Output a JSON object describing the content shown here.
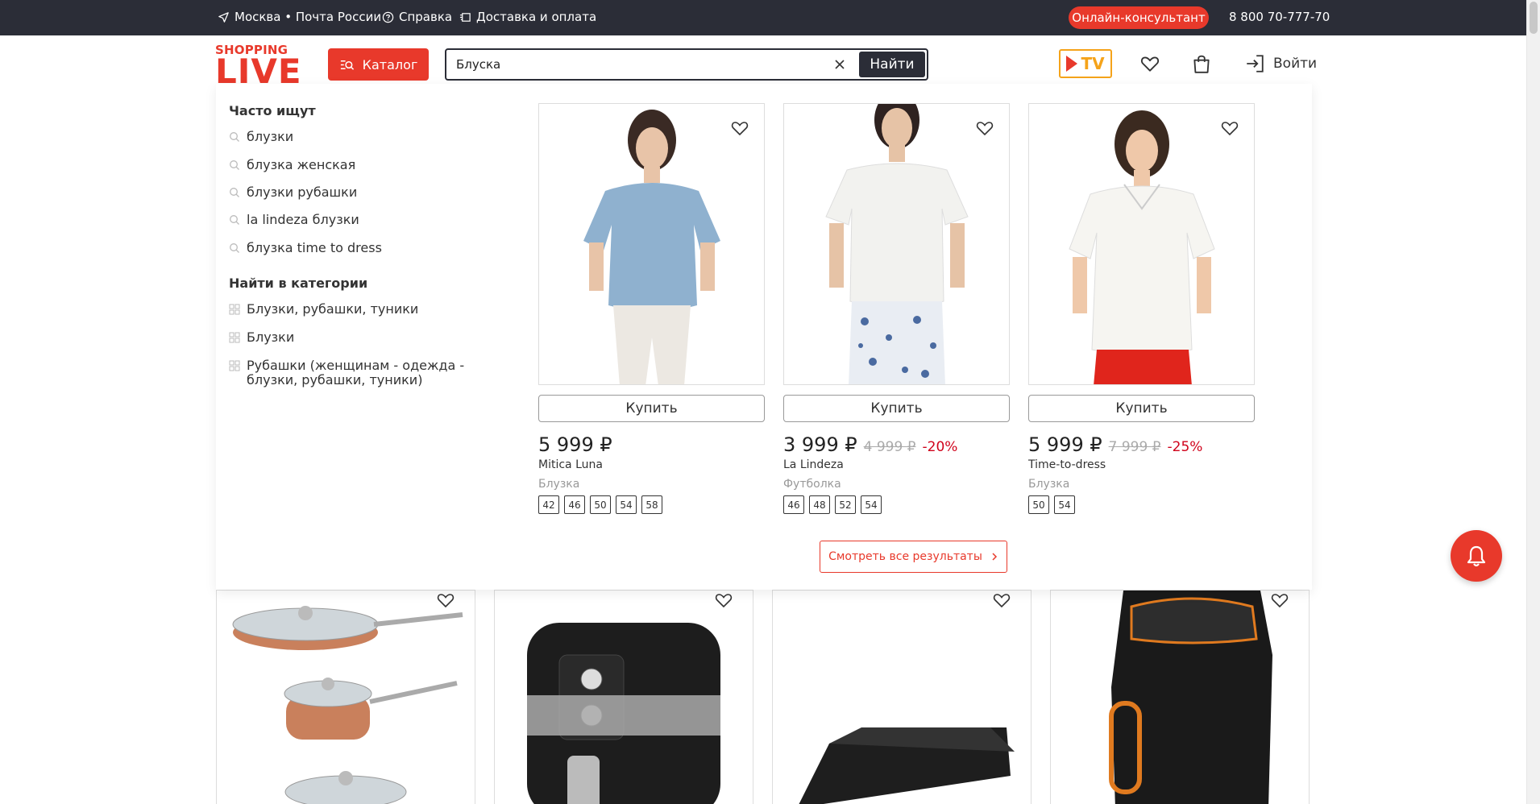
{
  "topbar": {
    "location": "Москва • Почта России",
    "help": "Справка",
    "delivery": "Доставка и оплата",
    "consultant": "Онлайн-консультант",
    "phone": "8 800 70-777-70"
  },
  "header": {
    "logo_top": "SHOPPING",
    "logo_bottom": "LIVE",
    "catalog": "Каталог",
    "search_value": "Блуска",
    "find": "Найти",
    "tv": "TV",
    "login": "Войти"
  },
  "dropdown": {
    "frequent_title": "Часто ищут",
    "frequent": [
      "блузки",
      "блузка женская",
      "блузки рубашки",
      "la lindeza блузки",
      "блузка time to dress"
    ],
    "category_title": "Найти в категории",
    "categories": [
      "Блузки, рубашки, туники",
      "Блузки",
      "Рубашки (женщинам - одежда - блузки, рубашки, туники)"
    ],
    "products": [
      {
        "buy": "Купить",
        "price": "5 999 ₽",
        "old_price": "",
        "discount": "",
        "brand": "Mitica Luna",
        "type": "Блузка",
        "sizes": [
          "42",
          "46",
          "50",
          "54",
          "58"
        ],
        "color": "#8fb1cf"
      },
      {
        "buy": "Купить",
        "price": "3 999 ₽",
        "old_price": "4 999 ₽",
        "discount": "-20%",
        "brand": "La Lindeza",
        "type": "Футболка",
        "sizes": [
          "46",
          "48",
          "52",
          "54"
        ],
        "color": "#f2f2ef"
      },
      {
        "buy": "Купить",
        "price": "5 999 ₽",
        "old_price": "7 999 ₽",
        "discount": "-25%",
        "brand": "Time-to-dress",
        "type": "Блузка",
        "sizes": [
          "50",
          "54"
        ],
        "color": "#f6f5f1"
      }
    ],
    "see_all": "Смотреть все результаты"
  },
  "colors": {
    "accent": "#e8392b",
    "dark": "#2b2d37",
    "discount": "#d0021b",
    "tv": "#f5a31a"
  }
}
